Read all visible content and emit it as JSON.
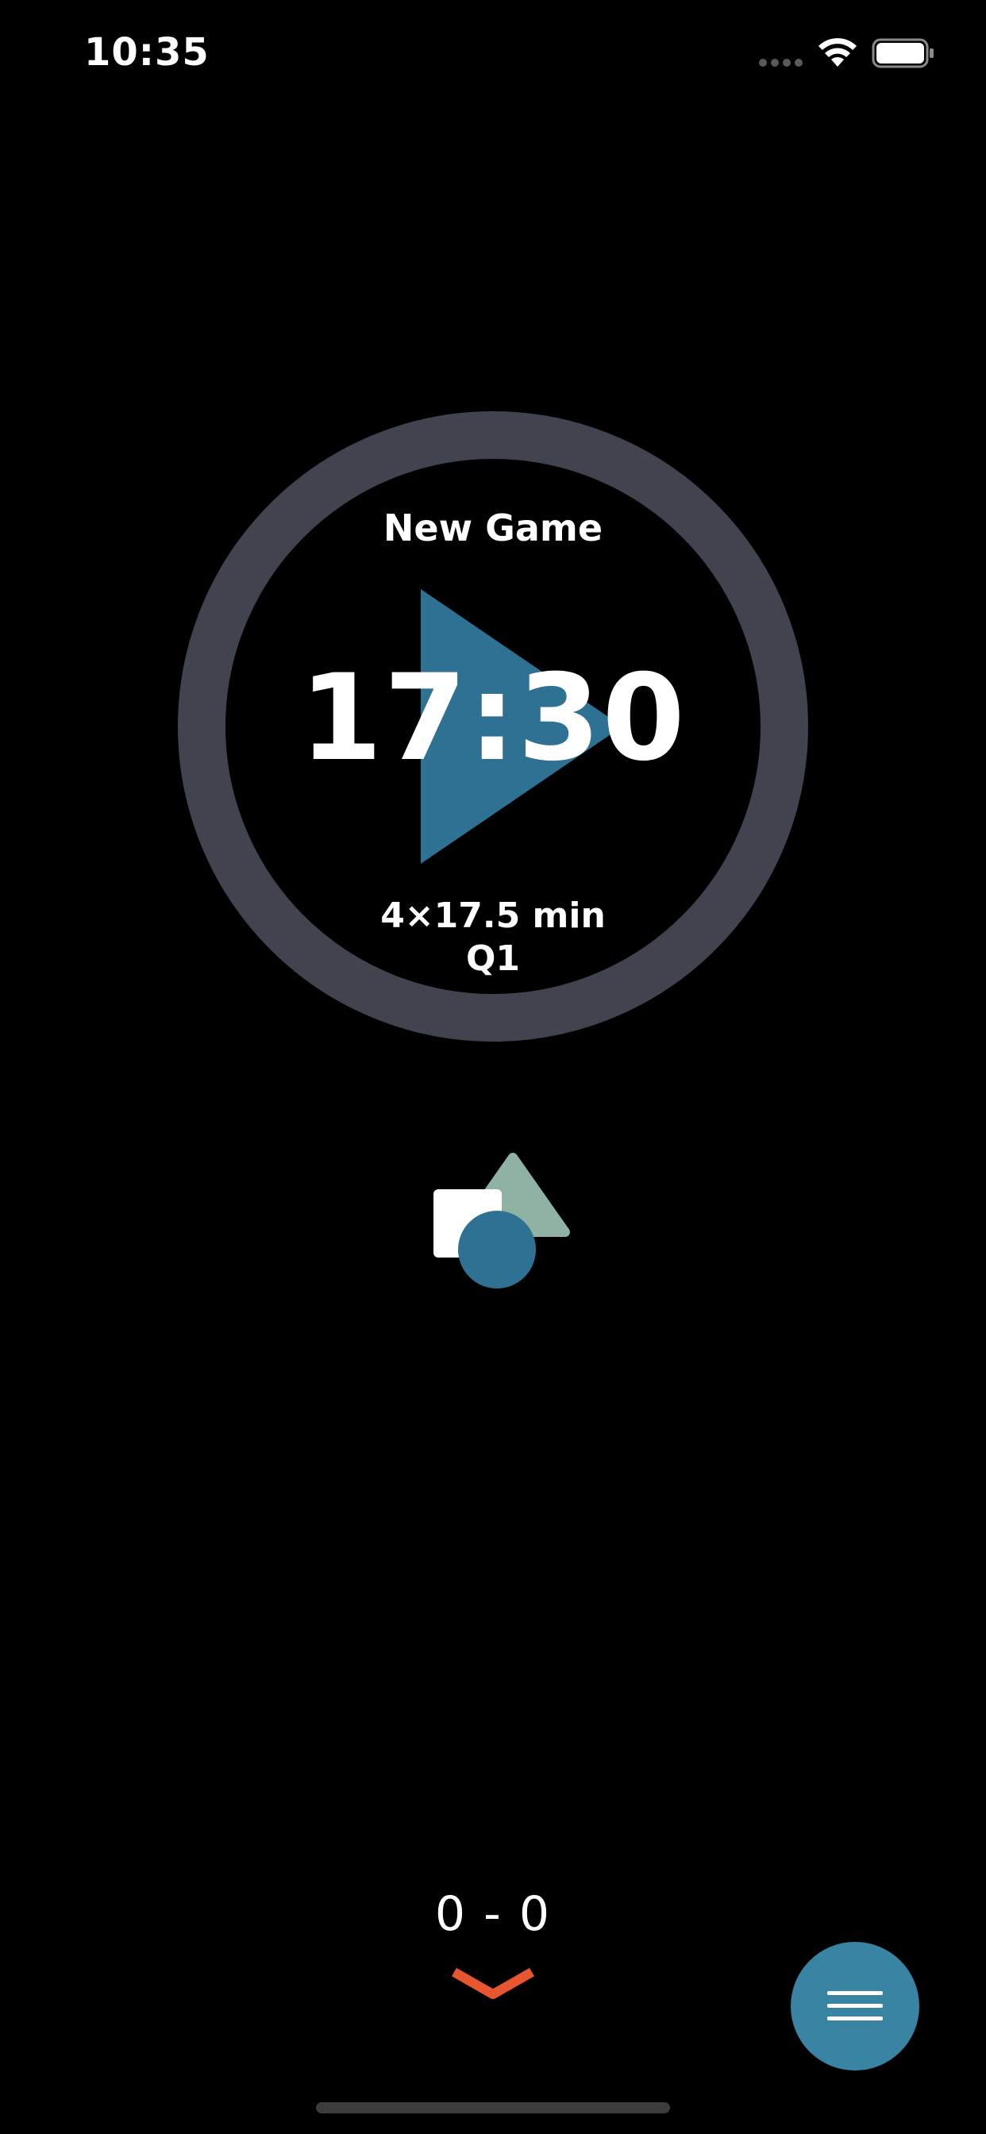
{
  "status_bar": {
    "time": "10:35",
    "icons": [
      "cellular-signal-icon",
      "wifi-icon",
      "battery-icon"
    ]
  },
  "timer": {
    "title": "New Game",
    "clock": "17:30",
    "format": "4×17.5 min",
    "period": "Q1",
    "play_icon": "play-icon"
  },
  "logo": {
    "icon": "shapes-logo-icon"
  },
  "score": {
    "text": "0 - 0"
  },
  "controls": {
    "expand_icon": "chevron-down-icon",
    "menu_icon": "hamburger-menu-icon"
  },
  "colors": {
    "background": "#000000",
    "ring": "#41434f",
    "accent_blue": "#2f7193",
    "menu_blue": "#3a84a3",
    "logo_green": "#8fb2a5",
    "chevron_orange": "#e8562f",
    "text": "#ffffff"
  }
}
